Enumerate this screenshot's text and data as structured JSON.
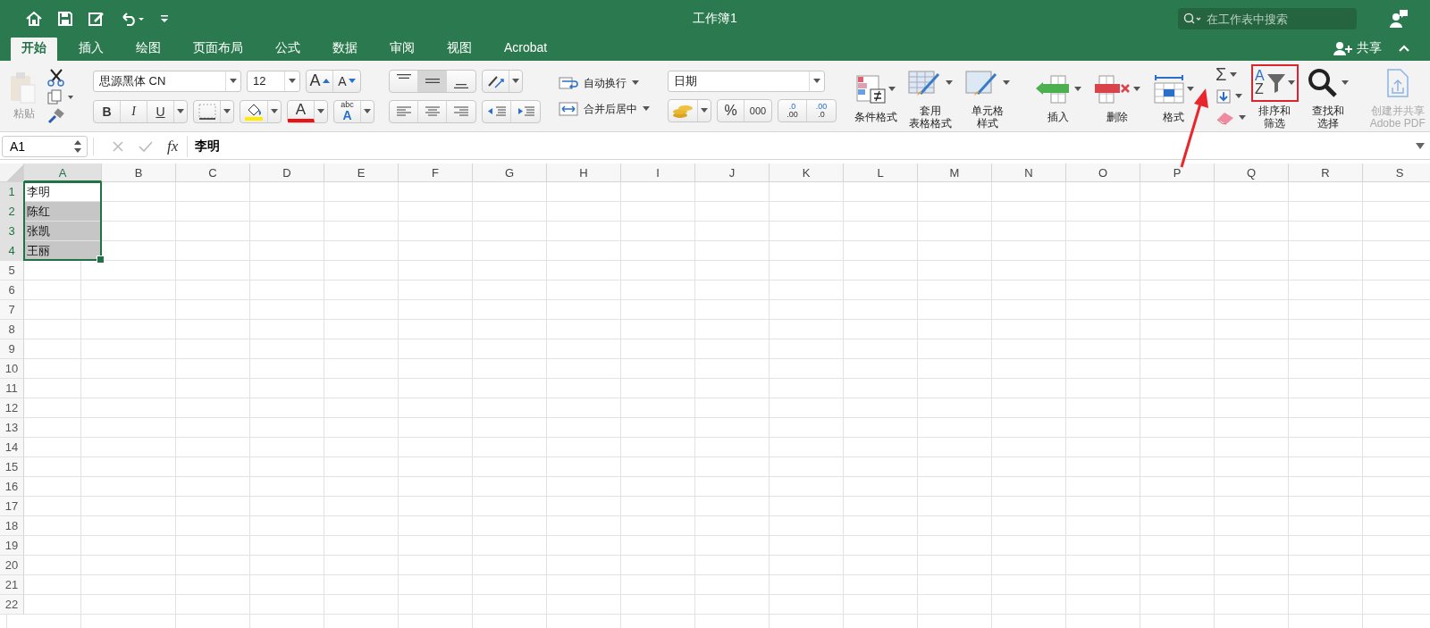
{
  "title_bar": {
    "title": "工作簿1",
    "search": {
      "placeholder": "在工作表中搜索"
    }
  },
  "tabs": [
    {
      "label": "开始",
      "selected": true
    },
    {
      "label": "插入",
      "selected": false
    },
    {
      "label": "绘图",
      "selected": false
    },
    {
      "label": "页面布局",
      "selected": false
    },
    {
      "label": "公式",
      "selected": false
    },
    {
      "label": "数据",
      "selected": false
    },
    {
      "label": "审阅",
      "selected": false
    },
    {
      "label": "视图",
      "selected": false
    },
    {
      "label": "Acrobat",
      "selected": false
    }
  ],
  "share": {
    "label": "共享"
  },
  "ribbon": {
    "paste": {
      "label": "粘贴",
      "disabled": true
    },
    "font": {
      "name": "思源黑体 CN",
      "size": "12"
    },
    "size_buttons": [
      "A",
      "A"
    ],
    "style_buttons": [
      {
        "kind": "bold",
        "label": "B"
      },
      {
        "kind": "italic",
        "label": "I"
      },
      {
        "kind": "underline",
        "label": "U"
      }
    ],
    "font_color_letter": "A",
    "abc": {
      "top": "abc",
      "letter": "A"
    },
    "vertical_align": [
      {
        "selected": false
      },
      {
        "selected": true
      },
      {
        "selected": false
      }
    ],
    "wrap_text": "自动换行",
    "merge": "合并后居中",
    "number_format": "日期",
    "number_buttons": [
      "%",
      "000"
    ],
    "decimal_buttons": [
      {
        "top": ".0",
        "bottom": ".00"
      },
      {
        "top": ".00",
        "bottom": ".0"
      }
    ],
    "big_buttons": [
      {
        "kind": "conditional",
        "lines": [
          "条件格式"
        ],
        "highlighted": false,
        "disabled": false
      },
      {
        "kind": "table",
        "lines": [
          "套用",
          "表格格式"
        ],
        "highlighted": false,
        "disabled": false
      },
      {
        "kind": "cellstyle",
        "lines": [
          "单元格",
          "样式"
        ],
        "highlighted": false,
        "disabled": false
      },
      {
        "kind": "insert",
        "lines": [
          "插入"
        ],
        "highlighted": false,
        "disabled": false
      },
      {
        "kind": "delete",
        "lines": [
          "删除"
        ],
        "highlighted": false,
        "disabled": false
      },
      {
        "kind": "format",
        "lines": [
          "格式"
        ],
        "highlighted": false,
        "disabled": false
      },
      {
        "kind": "sort",
        "lines": [
          "排序和",
          "筛选"
        ],
        "highlighted": true,
        "disabled": false,
        "letters": [
          "A",
          "Z"
        ]
      },
      {
        "kind": "find",
        "lines": [
          "查找和",
          "选择"
        ],
        "highlighted": false,
        "disabled": false
      },
      {
        "kind": "adobe",
        "lines": [
          "创建并共享",
          "Adobe PDF"
        ],
        "highlighted": false,
        "disabled": true
      }
    ],
    "sum_symbol": "Σ"
  },
  "formula_bar": {
    "name_box": "A1",
    "fx": "fx",
    "value": "李明"
  },
  "sheet": {
    "columns": [
      {
        "label": "A",
        "selected": true
      },
      {
        "label": "B",
        "selected": false
      },
      {
        "label": "C",
        "selected": false
      },
      {
        "label": "D",
        "selected": false
      },
      {
        "label": "E",
        "selected": false
      },
      {
        "label": "F",
        "selected": false
      },
      {
        "label": "G",
        "selected": false
      },
      {
        "label": "H",
        "selected": false
      },
      {
        "label": "I",
        "selected": false
      },
      {
        "label": "J",
        "selected": false
      },
      {
        "label": "K",
        "selected": false
      },
      {
        "label": "L",
        "selected": false
      },
      {
        "label": "M",
        "selected": false
      },
      {
        "label": "N",
        "selected": false
      },
      {
        "label": "O",
        "selected": false
      },
      {
        "label": "P",
        "selected": false
      },
      {
        "label": "Q",
        "selected": false
      },
      {
        "label": "R",
        "selected": false
      },
      {
        "label": "S",
        "selected": false
      }
    ],
    "rows": [
      {
        "label": "1",
        "selected": true,
        "cell_a": {
          "text": "李明",
          "highlighted": false
        }
      },
      {
        "label": "2",
        "selected": true,
        "cell_a": {
          "text": "陈红",
          "highlighted": true
        }
      },
      {
        "label": "3",
        "selected": true,
        "cell_a": {
          "text": "张凯",
          "highlighted": true
        }
      },
      {
        "label": "4",
        "selected": true,
        "cell_a": {
          "text": "王丽",
          "highlighted": true
        }
      },
      {
        "label": "5",
        "selected": false
      },
      {
        "label": "6",
        "selected": false
      },
      {
        "label": "7",
        "selected": false
      },
      {
        "label": "8",
        "selected": false
      },
      {
        "label": "9",
        "selected": false
      },
      {
        "label": "10",
        "selected": false
      },
      {
        "label": "11",
        "selected": false
      },
      {
        "label": "12",
        "selected": false
      },
      {
        "label": "13",
        "selected": false
      },
      {
        "label": "14",
        "selected": false
      },
      {
        "label": "15",
        "selected": false
      },
      {
        "label": "16",
        "selected": false
      },
      {
        "label": "17",
        "selected": false
      },
      {
        "label": "18",
        "selected": false
      },
      {
        "label": "19",
        "selected": false
      },
      {
        "label": "20",
        "selected": false
      },
      {
        "label": "21",
        "selected": false
      },
      {
        "label": "22",
        "selected": false
      }
    ]
  }
}
